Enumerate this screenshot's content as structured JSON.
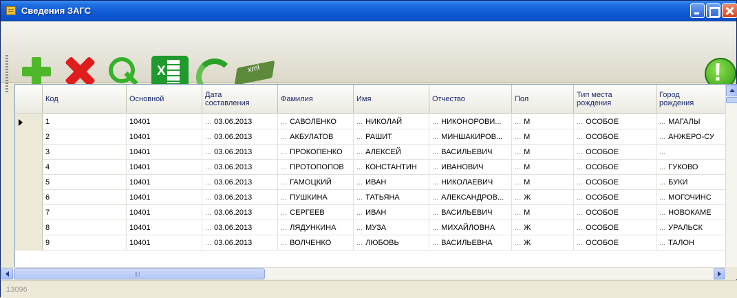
{
  "window": {
    "title": "Сведения ЗАГС",
    "accent_color": "#0b4fc8"
  },
  "toolbar": {
    "buttons": [
      {
        "icon": "add-plus-icon"
      },
      {
        "icon": "delete-x-icon"
      },
      {
        "icon": "search-magnifier-icon"
      },
      {
        "icon": "excel-export-icon"
      },
      {
        "icon": "refresh-arrows-icon"
      },
      {
        "icon": "xml-export-icon"
      },
      {
        "icon": "info-exclamation-icon"
      }
    ]
  },
  "grid": {
    "columns": [
      {
        "label": ""
      },
      {
        "label": "Код"
      },
      {
        "label": "Основной"
      },
      {
        "label": "Дата\nсоставления"
      },
      {
        "label": "Фамилия"
      },
      {
        "label": "Имя"
      },
      {
        "label": "Отчество"
      },
      {
        "label": "Пол"
      },
      {
        "label": "Тип места\nрождения"
      },
      {
        "label": "Город\nрождения"
      }
    ],
    "rows": [
      {
        "kod": "1",
        "osnovnoy": "10401",
        "data": "03.06.2013",
        "familiya": "САВОЛЕНКО",
        "imya": "НИКОЛАЙ",
        "otchestvo": "НИКОНОРОВИ...",
        "pol": "М",
        "tip": "ОСОБОЕ",
        "gorod": "МАГАЛЫ"
      },
      {
        "kod": "2",
        "osnovnoy": "10401",
        "data": "03.06.2013",
        "familiya": "АКБУЛАТОВ",
        "imya": "РАШИТ",
        "otchestvo": "МИНШАКИРОВ...",
        "pol": "М",
        "tip": "ОСОБОЕ",
        "gorod": "АНЖЕРО-СУ"
      },
      {
        "kod": "3",
        "osnovnoy": "10401",
        "data": "03.06.2013",
        "familiya": "ПРОКОПЕНКО",
        "imya": "АЛЕКСЕЙ",
        "otchestvo": "ВАСИЛЬЕВИЧ",
        "pol": "М",
        "tip": "ОСОБОЕ",
        "gorod": ""
      },
      {
        "kod": "4",
        "osnovnoy": "10401",
        "data": "03.06.2013",
        "familiya": "ПРОТОПОПОВ",
        "imya": "КОНСТАНТИН",
        "otchestvo": "ИВАНОВИЧ",
        "pol": "М",
        "tip": "ОСОБОЕ",
        "gorod": "ГУКОВО"
      },
      {
        "kod": "5",
        "osnovnoy": "10401",
        "data": "03.06.2013",
        "familiya": "ГАМОЦКИЙ",
        "imya": "ИВАН",
        "otchestvo": "НИКОЛАЕВИЧ",
        "pol": "М",
        "tip": "ОСОБОЕ",
        "gorod": "БУКИ"
      },
      {
        "kod": "6",
        "osnovnoy": "10401",
        "data": "03.06.2013",
        "familiya": "ПУШКИНА",
        "imya": "ТАТЬЯНА",
        "otchestvo": "АЛЕКСАНДРОВ...",
        "pol": "Ж",
        "tip": "ОСОБОЕ",
        "gorod": "МОГОЧИНС"
      },
      {
        "kod": "7",
        "osnovnoy": "10401",
        "data": "03.06.2013",
        "familiya": "СЕРГЕЕВ",
        "imya": "ИВАН",
        "otchestvo": "ВАСИЛЬЕВИЧ",
        "pol": "М",
        "tip": "ОСОБОЕ",
        "gorod": "НОВОКАМЕ"
      },
      {
        "kod": "8",
        "osnovnoy": "10401",
        "data": "03.06.2013",
        "familiya": "ЛЯДУНКИНА",
        "imya": "МУЗА",
        "otchestvo": "МИХАЙЛОВНА",
        "pol": "Ж",
        "tip": "ОСОБОЕ",
        "gorod": "УРАЛЬСК"
      },
      {
        "kod": "9",
        "osnovnoy": "10401",
        "data": "03.06.2013",
        "familiya": "ВОЛЧЕНКО",
        "imya": "ЛЮБОВЬ",
        "otchestvo": "ВАСИЛЬЕВНА",
        "pol": "Ж",
        "tip": "ОСОБОЕ",
        "gorod": "ТАЛОН"
      }
    ],
    "ellipsis": "..."
  },
  "status": {
    "record_count": "13096"
  }
}
